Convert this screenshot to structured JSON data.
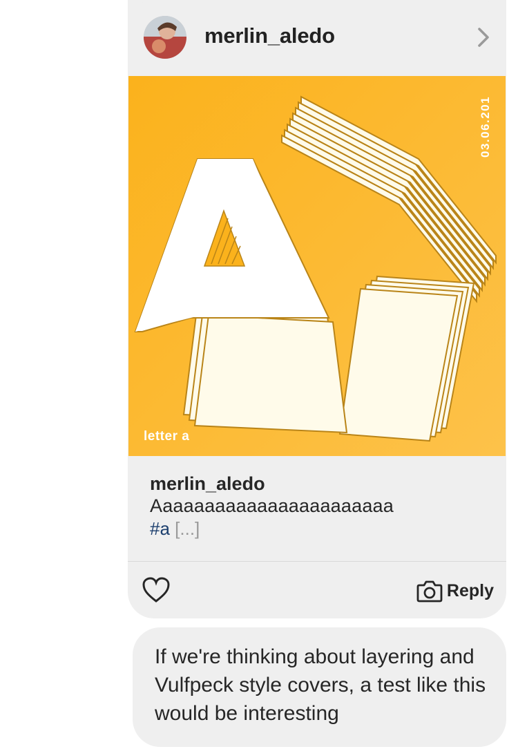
{
  "post": {
    "author": "merlin_aledo",
    "image": {
      "date_text": "03.06.201",
      "corner_text": "letter a",
      "background_color": "#fbb526",
      "accent_color": "#b98418"
    },
    "caption": {
      "username": "merlin_aledo",
      "text": "Aaaaaaaaaaaaaaaaaaaaaaa",
      "hashtag": "#a",
      "more": "[...]"
    },
    "actions": {
      "like_icon": "heart-icon",
      "reply_icon": "camera-icon",
      "reply_label": "Reply"
    }
  },
  "message": {
    "text": "If we're thinking about layering and Vulfpeck style covers, a test like this would be interesting"
  }
}
